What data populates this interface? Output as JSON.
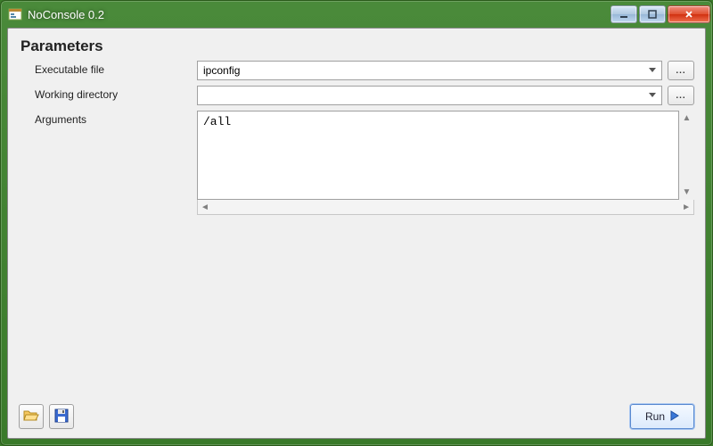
{
  "window": {
    "title": "NoConsole 0.2"
  },
  "section_title": "Parameters",
  "fields": {
    "executable": {
      "label": "Executable file",
      "value": "ipconfig",
      "browse": "..."
    },
    "workdir": {
      "label": "Working directory",
      "value": "",
      "browse": "..."
    },
    "arguments": {
      "label": "Arguments",
      "value": "/all"
    }
  },
  "actions": {
    "run": "Run"
  }
}
